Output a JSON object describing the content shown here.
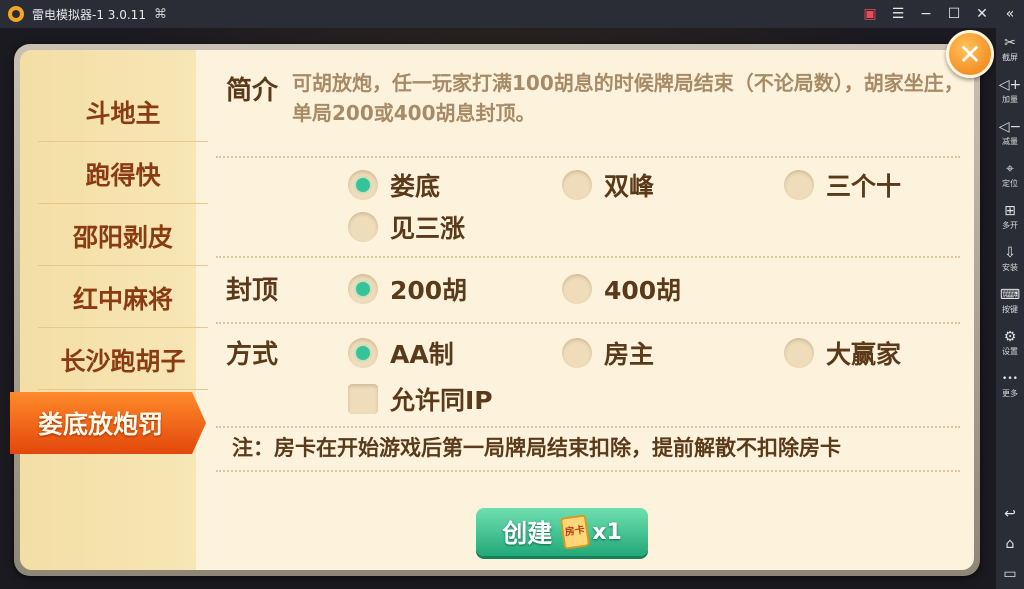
{
  "titlebar": {
    "title": "雷电模拟器-1 3.0.11",
    "icons": [
      "app-logo-icon",
      "gamepad-icon",
      "gift-icon",
      "menu-icon",
      "minimize-icon",
      "maximize-icon",
      "close-icon",
      "collapse-icon"
    ],
    "menu_glyph": "☰",
    "min_glyph": "−",
    "max_glyph": "☐",
    "close_glyph": "✕",
    "collapse_glyph": "«"
  },
  "sidebar": {
    "items": [
      {
        "icon": "scissors-icon",
        "glyph": "✂",
        "label": "截屏"
      },
      {
        "icon": "volume-up-icon",
        "glyph": "◁+",
        "label": "加量"
      },
      {
        "icon": "volume-down-icon",
        "glyph": "◁−",
        "label": "减量"
      },
      {
        "icon": "location-icon",
        "glyph": "⌖",
        "label": "定位"
      },
      {
        "icon": "multi-open-icon",
        "glyph": "⊞",
        "label": "多开"
      },
      {
        "icon": "apk-install-icon",
        "glyph": "⇩",
        "label": "安装"
      },
      {
        "icon": "keyboard-icon",
        "glyph": "⌨",
        "label": "按键"
      },
      {
        "icon": "settings-icon",
        "glyph": "⚙",
        "label": "设置"
      },
      {
        "icon": "more-icon",
        "glyph": "•••",
        "label": "更多"
      }
    ],
    "nav": [
      {
        "icon": "back-icon",
        "glyph": "↩"
      },
      {
        "icon": "home-icon",
        "glyph": "⌂"
      },
      {
        "icon": "recents-icon",
        "glyph": "▭"
      }
    ]
  },
  "dialog": {
    "close_glyph": "✕",
    "tabs": [
      {
        "label": "斗地主"
      },
      {
        "label": "跑得快"
      },
      {
        "label": "邵阳剥皮"
      },
      {
        "label": "红中麻将"
      },
      {
        "label": "长沙跑胡子"
      }
    ],
    "active_tab": "娄底放炮罚",
    "intro": {
      "label": "简介",
      "text": "可胡放炮，任一玩家打满100胡息的时候牌局结束（不论局数），胡家坐庄，单局200或400胡息封顶。"
    },
    "rules": {
      "options": [
        {
          "label": "娄底",
          "selected": true
        },
        {
          "label": "双峰",
          "selected": false
        },
        {
          "label": "三个十",
          "selected": false
        },
        {
          "label": "见三涨",
          "selected": false
        }
      ]
    },
    "cap": {
      "label": "封顶",
      "options": [
        {
          "label": "200胡",
          "selected": true
        },
        {
          "label": "400胡",
          "selected": false
        }
      ]
    },
    "mode": {
      "label": "方式",
      "options": [
        {
          "label": "AA制",
          "selected": true
        },
        {
          "label": "房主",
          "selected": false
        },
        {
          "label": "大赢家",
          "selected": false
        }
      ],
      "allow_same_ip": {
        "label": "允许同IP",
        "checked": false
      }
    },
    "note": "注：房卡在开始游戏后第一局牌局结束扣除，提前解散不扣除房卡",
    "create_button": {
      "label": "创建",
      "card_icon_text": "房卡",
      "card_count": "x1"
    },
    "colors": {
      "accent_tab": "#e3470c",
      "radio_selected": "#36c39a",
      "create_button": "#22a878",
      "close_button": "#f07a12"
    }
  }
}
